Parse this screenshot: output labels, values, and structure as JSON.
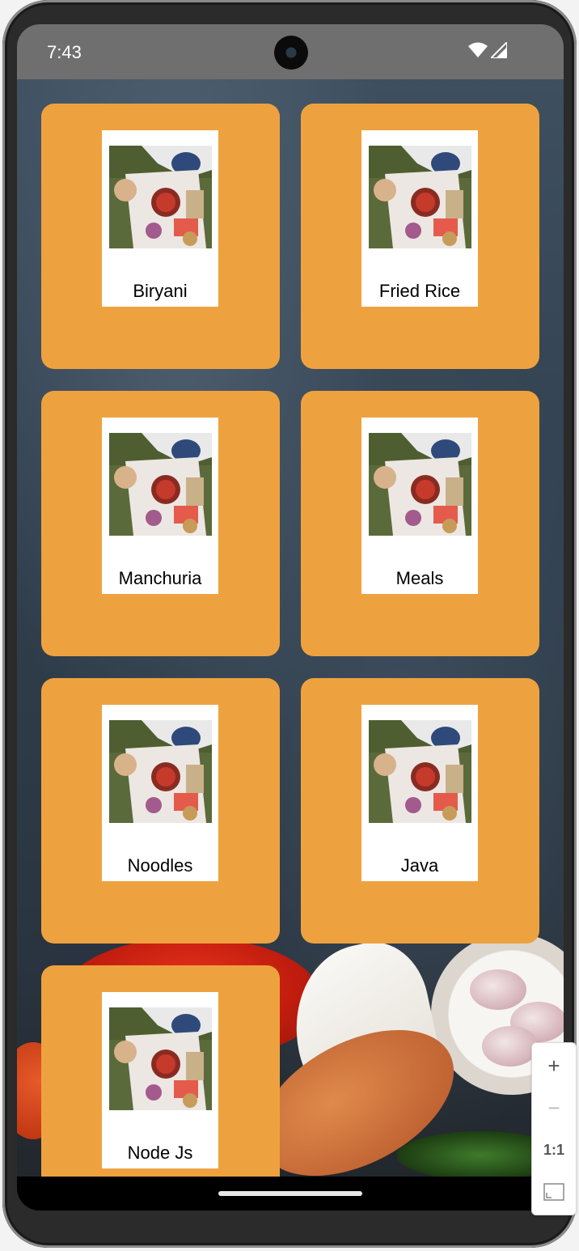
{
  "status_bar": {
    "time": "7:43",
    "icons": [
      "wifi-icon",
      "signal-icon"
    ]
  },
  "categories": [
    {
      "label": "Biryani"
    },
    {
      "label": "Fried Rice"
    },
    {
      "label": "Manchuria"
    },
    {
      "label": "Meals"
    },
    {
      "label": "Noodles"
    },
    {
      "label": "Java"
    },
    {
      "label": "Node Js"
    }
  ],
  "emulator_zoom": {
    "zoom_in_label": "+",
    "zoom_out_label": "−",
    "actual_size_label": "1:1",
    "fit_icon": "fit-screen-icon"
  },
  "colors": {
    "card_background": "#eea23f",
    "status_bar": "#6f6f6f"
  }
}
